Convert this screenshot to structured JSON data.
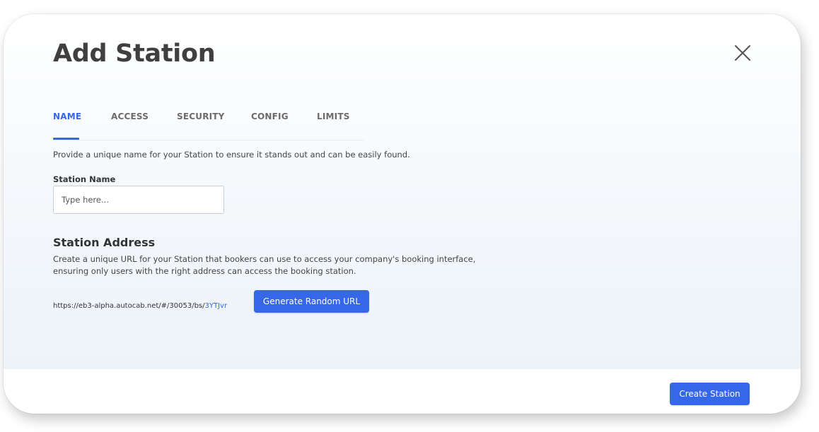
{
  "modal": {
    "title": "Add Station",
    "close_icon": "close-icon"
  },
  "tabs": [
    {
      "label": "NAME",
      "active": true
    },
    {
      "label": "ACCESS",
      "active": false
    },
    {
      "label": "SECURITY",
      "active": false
    },
    {
      "label": "CONFIG",
      "active": false
    },
    {
      "label": "LIMITS",
      "active": false
    }
  ],
  "name_section": {
    "description": "Provide a unique name for your Station to ensure it stands out and can be easily found.",
    "field_label": "Station Name",
    "placeholder": "Type here...",
    "value": ""
  },
  "address_section": {
    "title": "Station Address",
    "description": "Create a unique URL for your Station that bookers can use to access your company's booking interface, ensuring only users with the right address can access the booking station.",
    "url_base": "https://eb3-alpha.autocab.net/#/30053/bs/",
    "url_slug": "3YTJvr",
    "generate_button_label": "Generate Random URL"
  },
  "footer": {
    "create_button_label": "Create Station"
  },
  "colors": {
    "accent": "#3567e8",
    "title_text": "#3f3f3f",
    "tab_inactive": "#6b6b6b"
  }
}
